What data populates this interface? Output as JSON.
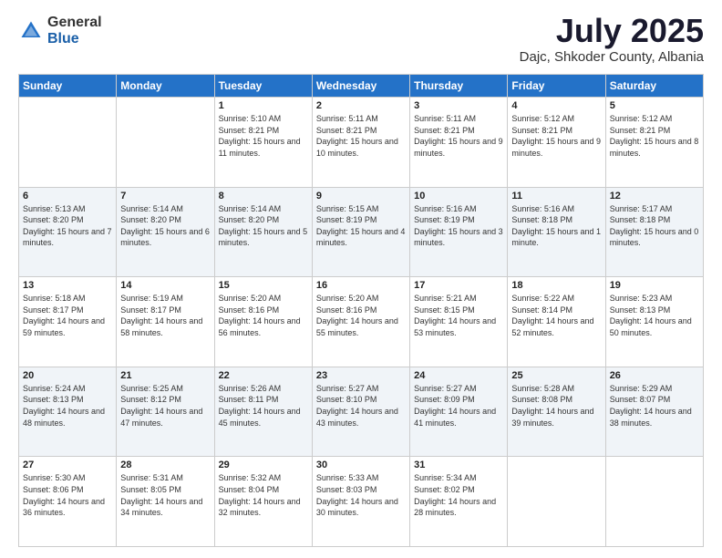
{
  "header": {
    "logo_general": "General",
    "logo_blue": "Blue",
    "month_title": "July 2025",
    "location": "Dajc, Shkoder County, Albania"
  },
  "days_of_week": [
    "Sunday",
    "Monday",
    "Tuesday",
    "Wednesday",
    "Thursday",
    "Friday",
    "Saturday"
  ],
  "weeks": [
    [
      {
        "day": "",
        "info": ""
      },
      {
        "day": "",
        "info": ""
      },
      {
        "day": "1",
        "info": "Sunrise: 5:10 AM\nSunset: 8:21 PM\nDaylight: 15 hours and 11 minutes."
      },
      {
        "day": "2",
        "info": "Sunrise: 5:11 AM\nSunset: 8:21 PM\nDaylight: 15 hours and 10 minutes."
      },
      {
        "day": "3",
        "info": "Sunrise: 5:11 AM\nSunset: 8:21 PM\nDaylight: 15 hours and 9 minutes."
      },
      {
        "day": "4",
        "info": "Sunrise: 5:12 AM\nSunset: 8:21 PM\nDaylight: 15 hours and 9 minutes."
      },
      {
        "day": "5",
        "info": "Sunrise: 5:12 AM\nSunset: 8:21 PM\nDaylight: 15 hours and 8 minutes."
      }
    ],
    [
      {
        "day": "6",
        "info": "Sunrise: 5:13 AM\nSunset: 8:20 PM\nDaylight: 15 hours and 7 minutes."
      },
      {
        "day": "7",
        "info": "Sunrise: 5:14 AM\nSunset: 8:20 PM\nDaylight: 15 hours and 6 minutes."
      },
      {
        "day": "8",
        "info": "Sunrise: 5:14 AM\nSunset: 8:20 PM\nDaylight: 15 hours and 5 minutes."
      },
      {
        "day": "9",
        "info": "Sunrise: 5:15 AM\nSunset: 8:19 PM\nDaylight: 15 hours and 4 minutes."
      },
      {
        "day": "10",
        "info": "Sunrise: 5:16 AM\nSunset: 8:19 PM\nDaylight: 15 hours and 3 minutes."
      },
      {
        "day": "11",
        "info": "Sunrise: 5:16 AM\nSunset: 8:18 PM\nDaylight: 15 hours and 1 minute."
      },
      {
        "day": "12",
        "info": "Sunrise: 5:17 AM\nSunset: 8:18 PM\nDaylight: 15 hours and 0 minutes."
      }
    ],
    [
      {
        "day": "13",
        "info": "Sunrise: 5:18 AM\nSunset: 8:17 PM\nDaylight: 14 hours and 59 minutes."
      },
      {
        "day": "14",
        "info": "Sunrise: 5:19 AM\nSunset: 8:17 PM\nDaylight: 14 hours and 58 minutes."
      },
      {
        "day": "15",
        "info": "Sunrise: 5:20 AM\nSunset: 8:16 PM\nDaylight: 14 hours and 56 minutes."
      },
      {
        "day": "16",
        "info": "Sunrise: 5:20 AM\nSunset: 8:16 PM\nDaylight: 14 hours and 55 minutes."
      },
      {
        "day": "17",
        "info": "Sunrise: 5:21 AM\nSunset: 8:15 PM\nDaylight: 14 hours and 53 minutes."
      },
      {
        "day": "18",
        "info": "Sunrise: 5:22 AM\nSunset: 8:14 PM\nDaylight: 14 hours and 52 minutes."
      },
      {
        "day": "19",
        "info": "Sunrise: 5:23 AM\nSunset: 8:13 PM\nDaylight: 14 hours and 50 minutes."
      }
    ],
    [
      {
        "day": "20",
        "info": "Sunrise: 5:24 AM\nSunset: 8:13 PM\nDaylight: 14 hours and 48 minutes."
      },
      {
        "day": "21",
        "info": "Sunrise: 5:25 AM\nSunset: 8:12 PM\nDaylight: 14 hours and 47 minutes."
      },
      {
        "day": "22",
        "info": "Sunrise: 5:26 AM\nSunset: 8:11 PM\nDaylight: 14 hours and 45 minutes."
      },
      {
        "day": "23",
        "info": "Sunrise: 5:27 AM\nSunset: 8:10 PM\nDaylight: 14 hours and 43 minutes."
      },
      {
        "day": "24",
        "info": "Sunrise: 5:27 AM\nSunset: 8:09 PM\nDaylight: 14 hours and 41 minutes."
      },
      {
        "day": "25",
        "info": "Sunrise: 5:28 AM\nSunset: 8:08 PM\nDaylight: 14 hours and 39 minutes."
      },
      {
        "day": "26",
        "info": "Sunrise: 5:29 AM\nSunset: 8:07 PM\nDaylight: 14 hours and 38 minutes."
      }
    ],
    [
      {
        "day": "27",
        "info": "Sunrise: 5:30 AM\nSunset: 8:06 PM\nDaylight: 14 hours and 36 minutes."
      },
      {
        "day": "28",
        "info": "Sunrise: 5:31 AM\nSunset: 8:05 PM\nDaylight: 14 hours and 34 minutes."
      },
      {
        "day": "29",
        "info": "Sunrise: 5:32 AM\nSunset: 8:04 PM\nDaylight: 14 hours and 32 minutes."
      },
      {
        "day": "30",
        "info": "Sunrise: 5:33 AM\nSunset: 8:03 PM\nDaylight: 14 hours and 30 minutes."
      },
      {
        "day": "31",
        "info": "Sunrise: 5:34 AM\nSunset: 8:02 PM\nDaylight: 14 hours and 28 minutes."
      },
      {
        "day": "",
        "info": ""
      },
      {
        "day": "",
        "info": ""
      }
    ]
  ]
}
